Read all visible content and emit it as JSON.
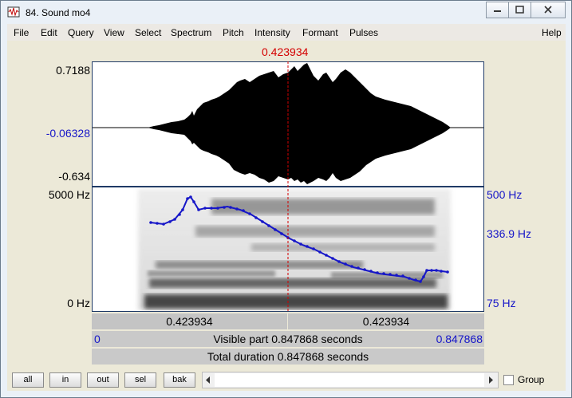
{
  "window": {
    "title": "84. Sound mo4"
  },
  "menu": {
    "items": [
      "File",
      "Edit",
      "Query",
      "View",
      "Select",
      "Spectrum",
      "Pitch",
      "Intensity",
      "Formant",
      "Pulses"
    ],
    "help": "Help"
  },
  "cursor_time": "0.423934",
  "waveform": {
    "top_label": "0.7188",
    "mid_label": "-0.06328",
    "bottom_label": "-0.634"
  },
  "spectrogram": {
    "freq_top": "5000 Hz",
    "freq_bottom": "0 Hz",
    "pitch_top": "500 Hz",
    "pitch_mid": "336.9 Hz",
    "pitch_bottom": "75 Hz"
  },
  "time_bars": {
    "left_segment": "0.423934",
    "right_segment": "0.423934",
    "visible_start": "0",
    "visible_text": "Visible part 0.847868 seconds",
    "visible_end": "0.847868",
    "total_text": "Total duration 0.847868 seconds"
  },
  "buttons": {
    "all": "all",
    "in": "in",
    "out": "out",
    "sel": "sel",
    "bak": "bak"
  },
  "group": {
    "label": "Group"
  },
  "colors": {
    "cursor": "#d40000",
    "pitch": "#1616c8",
    "wave": "#000000"
  },
  "icons": [
    "sound-app-icon",
    "minimize-icon",
    "maximize-icon",
    "close-icon",
    "scroll-left-icon",
    "scroll-right-icon"
  ]
}
